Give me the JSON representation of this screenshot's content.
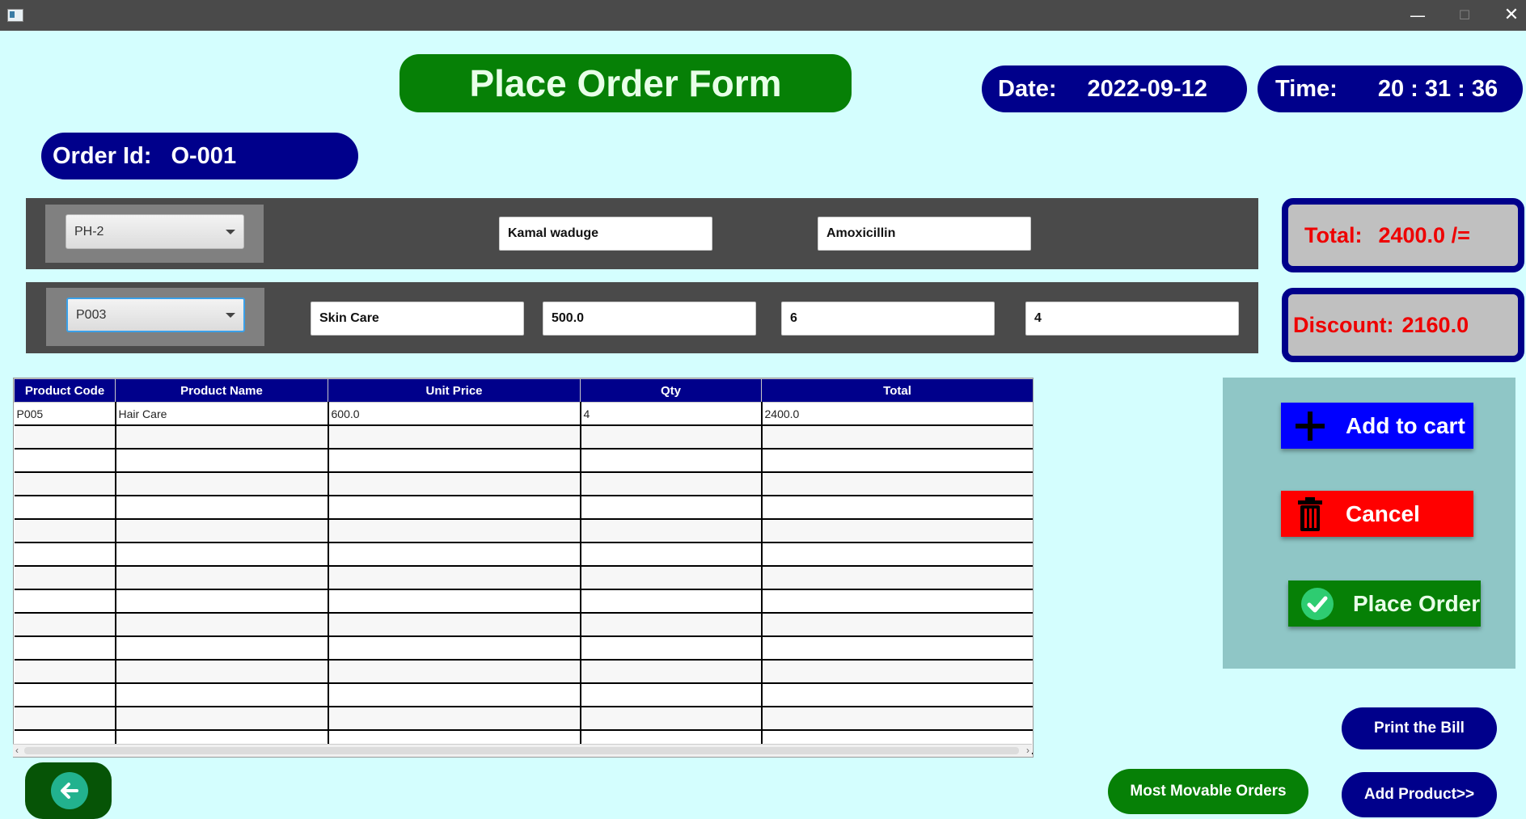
{
  "window": {
    "minimize": "—",
    "maximize": "☐",
    "close": "✕"
  },
  "title": "Place Order Form",
  "date": {
    "label": "Date:",
    "value": "2022-09-12"
  },
  "time": {
    "label": "Time:",
    "value": "20 : 31 : 36"
  },
  "order": {
    "label": "Order Id:",
    "value": "O-001"
  },
  "customer": {
    "id": "PH-2",
    "name": "Kamal waduge",
    "medicine": "Amoxicillin"
  },
  "product": {
    "code": "P003",
    "name": "Skin Care",
    "unit_price": "500.0",
    "qty_on_hand": "6",
    "qty": "4"
  },
  "summary": {
    "total_label": "Total:",
    "total_value": "2400.0 /=",
    "discount_label": "Discount:",
    "discount_value": "2160.0"
  },
  "table": {
    "headers": [
      "Product Code",
      "Product Name",
      "Unit Price",
      "Qty",
      "Total"
    ],
    "rows": [
      [
        "P005",
        "Hair Care",
        "600.0",
        "4",
        "2400.0"
      ]
    ]
  },
  "buttons": {
    "add_to_cart": "Add to cart",
    "cancel": "Cancel",
    "place_order": "Place Order",
    "print_bill": "Print the Bill",
    "most_movable": "Most Movable Orders",
    "add_product": "Add Product>>"
  },
  "colors": {
    "background": "#d4fefe",
    "navy": "#00008b",
    "green": "#068006",
    "red": "#ff0000",
    "blue": "#0000ff"
  }
}
